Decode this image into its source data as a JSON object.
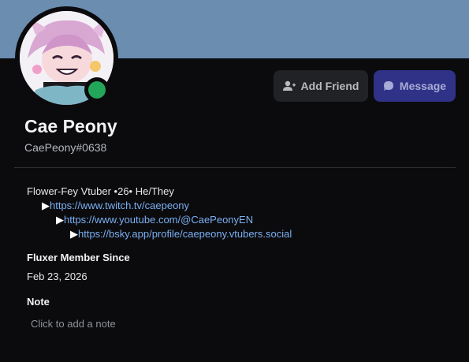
{
  "profile": {
    "display_name": "Cae Peony",
    "username": "CaePeony#0638",
    "status": "online",
    "status_color": "#23a55a"
  },
  "actions": {
    "add_friend_label": "Add Friend",
    "message_label": "Message"
  },
  "bio": {
    "line1": "Flower-Fey Vtuber •26•  He/They",
    "links": [
      {
        "arrow": "▶",
        "url": "https://www.twitch.tv/caepeony"
      },
      {
        "arrow": "▶",
        "url": "https://www.youtube.com/@CaePeonyEN"
      },
      {
        "arrow": "▶",
        "url": "https://bsky.app/profile/caepeony.vtubers.social"
      }
    ]
  },
  "member_since": {
    "title": "Fluxer Member Since",
    "value": "Feb 23, 2026"
  },
  "note": {
    "title": "Note",
    "placeholder": "Click to add a note"
  },
  "colors": {
    "banner": "#6a8db0",
    "background": "#0b0b0e",
    "link": "#7aaff0",
    "message_button": "#2f3287"
  },
  "icons": {
    "add_friend": "add-user-icon",
    "message": "chat-bubble-icon"
  }
}
